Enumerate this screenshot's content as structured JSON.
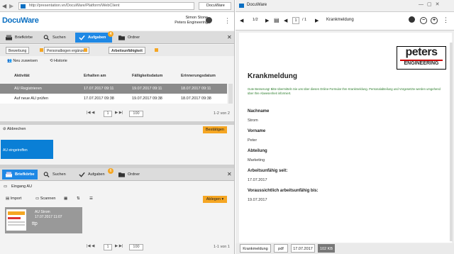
{
  "browser": {
    "left_tab_title": "DocuWare",
    "url": "http://presentation.vn/DocuWare/Platform/WebClient",
    "right_tab_title": "DocuWare"
  },
  "header": {
    "logo": "DocuWare",
    "user_name": "Simon Stone",
    "company": "Peters Engineering"
  },
  "nav": {
    "tabs": [
      {
        "label": "Briefkörbe"
      },
      {
        "label": "Suchen"
      },
      {
        "label": "Aufgaben",
        "badge": "4"
      },
      {
        "label": "Ordner"
      }
    ]
  },
  "subtabs": [
    "Bewerbung",
    "Personalbogen ergänzen",
    "Arbeitsunfähigkeit"
  ],
  "toolbar": {
    "reassign": "Neu zuweisen",
    "history": "Historie"
  },
  "table": {
    "headers": [
      "Aktivität",
      "Erhalten am",
      "Fälligkeitsdatum",
      "Erinnerungsdatum"
    ],
    "rows": [
      [
        "AU Registrieren",
        "17.07.2017 09:11",
        "19.07.2017 09:11",
        "18.07.2017 09:11"
      ],
      [
        "Auf neue AU prüfen",
        "17.07.2017 09:38",
        "19.07.2017 09:38",
        "18.07.2017 09:38"
      ]
    ]
  },
  "pager1": {
    "page": "1",
    "per_page": "100",
    "count": "1-2 von 2"
  },
  "actions": {
    "cancel": "Abbrechen",
    "confirm": "Bestätigen"
  },
  "assigned_item": "AU eingetroffen",
  "nav2": {
    "tabs": [
      {
        "label": "Briefkörbe"
      },
      {
        "label": "Suchen"
      },
      {
        "label": "Aufgaben",
        "badge": "6"
      },
      {
        "label": "Ordner"
      }
    ]
  },
  "tray": {
    "title": "Eingang AU",
    "import": "Import",
    "scan": "Scannen",
    "file": "Ablegen",
    "doc_title": "AU Strom",
    "doc_date": "17.07.2017 11:07",
    "doc_type": "ttp"
  },
  "pager2": {
    "page": "1",
    "per_page": "100",
    "count": "1-1 von 1"
  },
  "viewer": {
    "page": "1/2",
    "page_input": "1",
    "page_total": "/ 1",
    "doc_name": "Krankmeldung"
  },
  "doc": {
    "brand_top": "peters",
    "brand_bottom": "ENGINEERING",
    "title": "Krankmeldung",
    "intro": "Gute Besserung! Bitte übermitteln Sie uns über dieses Online-Formular Ihre Krankmeldung. Personalabteilung und Vorgesetzte werden umgehend über Ihre Abwesenheit informiert.",
    "fields": [
      {
        "label": "Nachname",
        "value": "Strom"
      },
      {
        "label": "Vorname",
        "value": "Peter"
      },
      {
        "label": "Abteilung",
        "value": "Marketing"
      },
      {
        "label": "Arbeitsunfähig seit:",
        "value": "17.07.2017"
      },
      {
        "label": "Voraussichtlich arbeitsunfähig bis:",
        "value": "19.07.2017"
      }
    ]
  },
  "footer": {
    "doc_name": "Krankmeldung",
    "type": "pdf",
    "date": "17.07.2017",
    "size": "102 KB"
  },
  "colors": {
    "accent": "#1e88e5",
    "orange": "#f5a623",
    "selected_row": "#888888"
  }
}
